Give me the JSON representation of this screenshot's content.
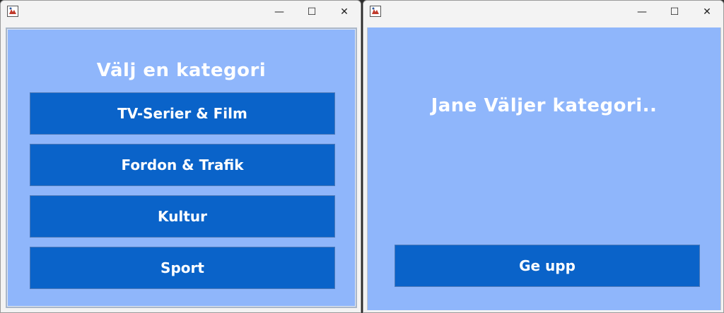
{
  "left_window": {
    "heading": "Välj en kategori",
    "categories": [
      {
        "label": "TV-Serier & Film"
      },
      {
        "label": "Fordon & Trafik"
      },
      {
        "label": "Kultur"
      },
      {
        "label": "Sport"
      }
    ]
  },
  "right_window": {
    "heading": "Jane Väljer kategori..",
    "give_up_label": "Ge upp"
  },
  "titlebar": {
    "minimize_symbol": "—",
    "maximize_symbol": "☐",
    "close_symbol": "✕"
  },
  "colors": {
    "content_background": "#8fb6fb",
    "button_background": "#0a63c9",
    "text": "#ffffff"
  },
  "icons": {
    "app_icon": "java-app-icon"
  }
}
